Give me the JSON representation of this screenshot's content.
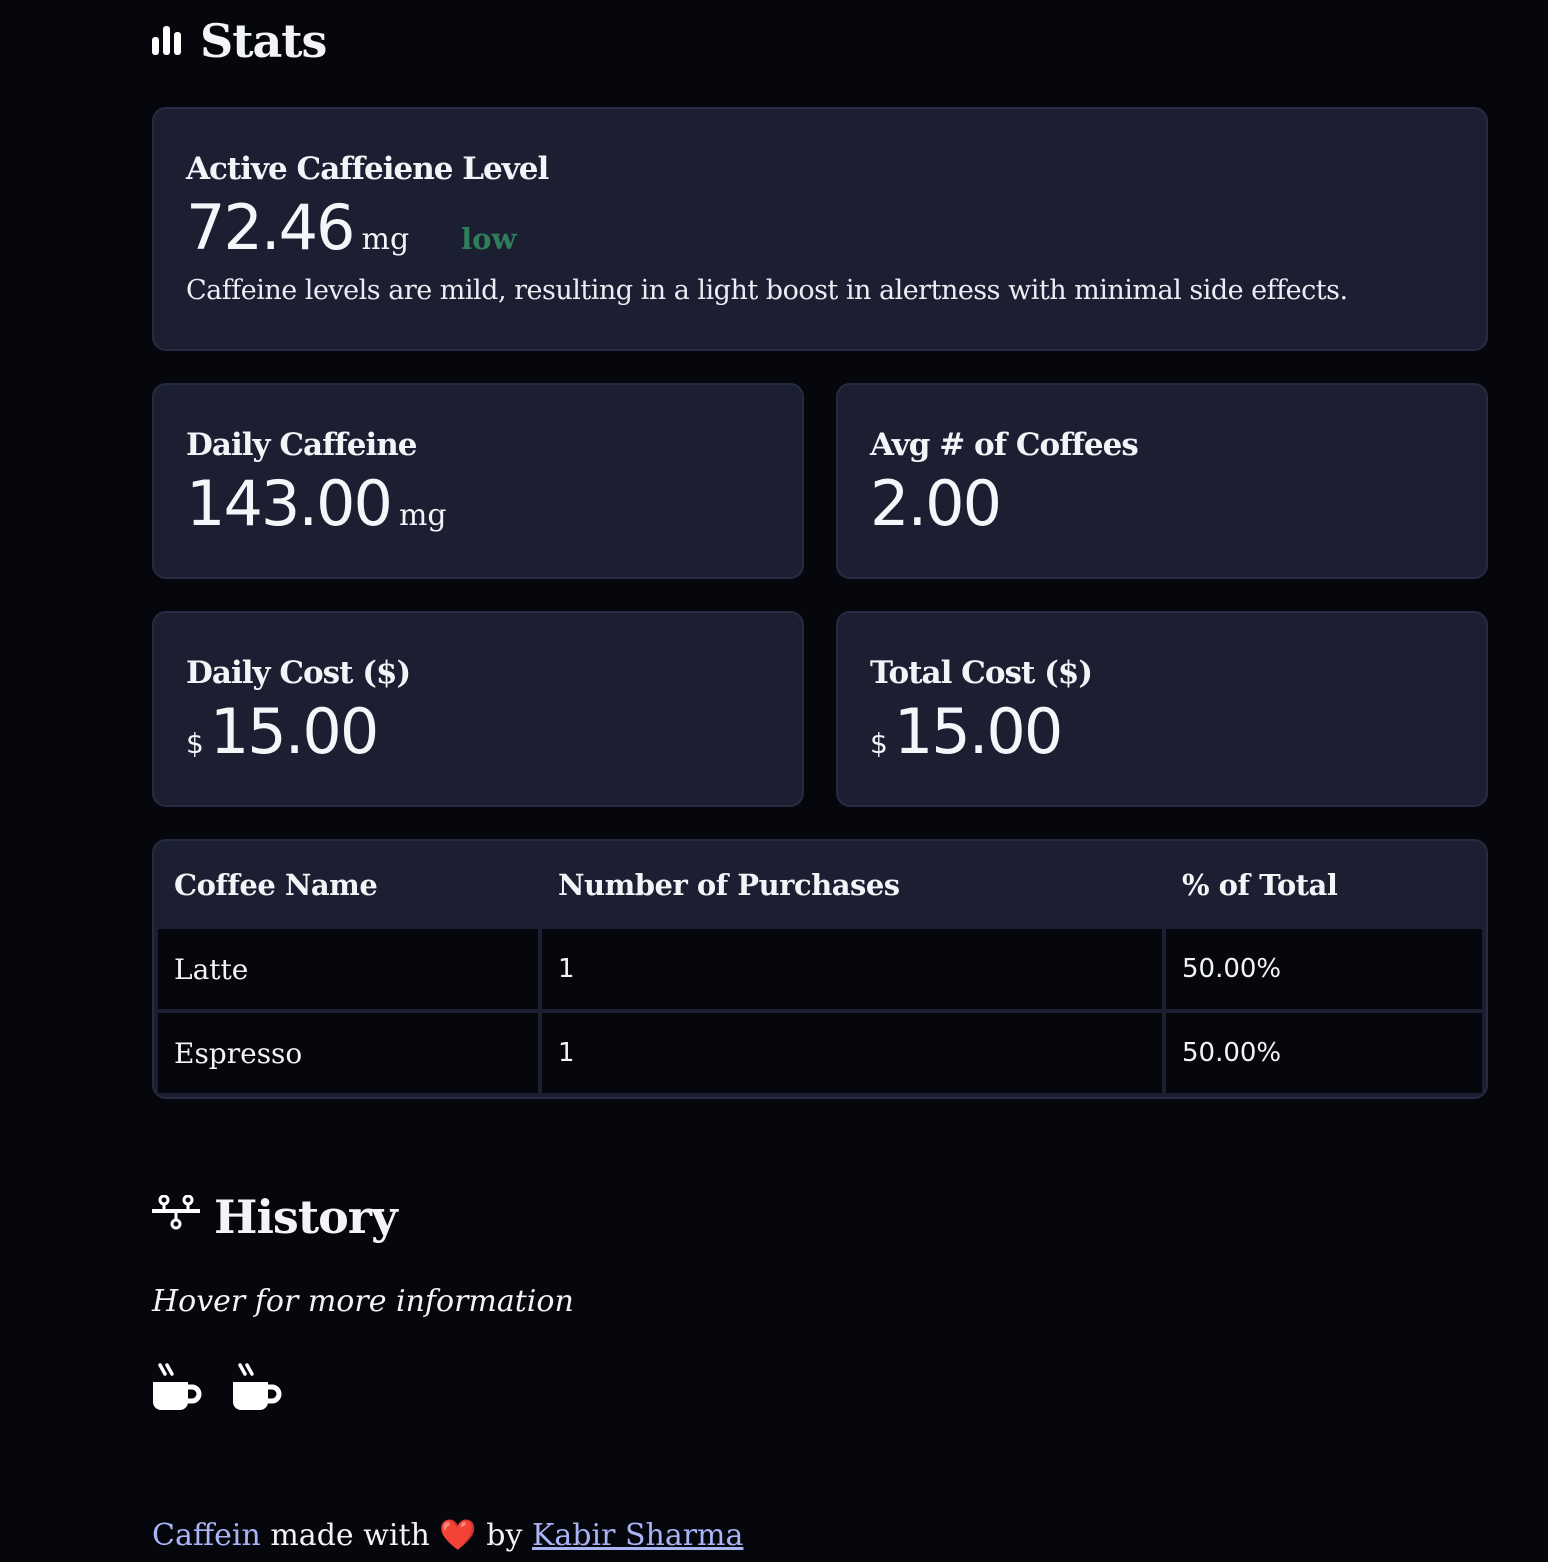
{
  "stats": {
    "title": "Stats",
    "icon": "bar-chart-icon"
  },
  "active_caffeine": {
    "label": "Active Caffeiene Level",
    "value": "72.46",
    "unit": "mg",
    "status": "low",
    "status_color": "#2f7d5a",
    "description": "Caffeine levels are mild, resulting in a light boost in alertness with minimal side effects."
  },
  "daily_caffeine": {
    "label": "Daily Caffeine",
    "value": "143.00",
    "unit": "mg"
  },
  "avg_coffees": {
    "label": "Avg # of Coffees",
    "value": "2.00"
  },
  "daily_cost": {
    "label": "Daily Cost ($)",
    "prefix": "$",
    "value": "15.00"
  },
  "total_cost": {
    "label": "Total Cost ($)",
    "prefix": "$",
    "value": "15.00"
  },
  "table": {
    "headers": [
      "Coffee Name",
      "Number of Purchases",
      "% of Total"
    ],
    "rows": [
      [
        "Latte",
        "1",
        "50.00%"
      ],
      [
        "Espresso",
        "1",
        "50.00%"
      ]
    ]
  },
  "history": {
    "title": "History",
    "icon": "timeline-icon",
    "hint": "Hover for more information",
    "entries": [
      "coffee-cup-icon",
      "coffee-cup-icon"
    ]
  },
  "footer": {
    "app_name": "Caffein",
    "made_with": " made with ",
    "heart": "❤️",
    "by": " by ",
    "author": "Kabir Sharma"
  },
  "colors": {
    "background": "#05070d",
    "card": "#1b1f31",
    "link": "#a9b4f5"
  }
}
